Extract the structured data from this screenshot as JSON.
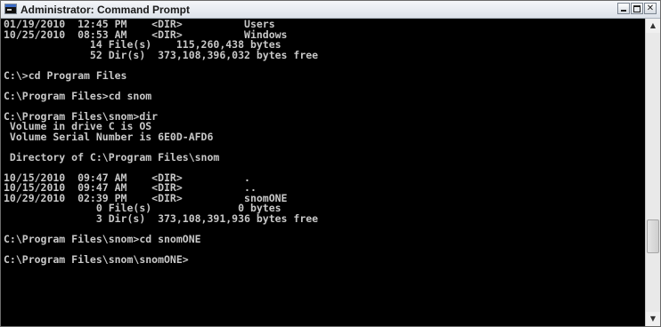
{
  "window": {
    "title": "Administrator: Command Prompt",
    "controls": {
      "minimize": "minimize",
      "maximize": "maximize",
      "close": "✕"
    }
  },
  "console": {
    "text_color": "#c8c8c8",
    "background_color": "#000000",
    "lines": [
      "01/19/2010  12:45 PM    <DIR>          Users",
      "10/25/2010  08:53 AM    <DIR>          Windows",
      "              14 File(s)    115,260,438 bytes",
      "              52 Dir(s)  373,108,396,032 bytes free",
      "",
      "C:\\>cd Program Files",
      "",
      "C:\\Program Files>cd snom",
      "",
      "C:\\Program Files\\snom>dir",
      " Volume in drive C is OS",
      " Volume Serial Number is 6E0D-AFD6",
      "",
      " Directory of C:\\Program Files\\snom",
      "",
      "10/15/2010  09:47 AM    <DIR>          .",
      "10/15/2010  09:47 AM    <DIR>          ..",
      "10/29/2010  02:39 PM    <DIR>          snomONE",
      "               0 File(s)              0 bytes",
      "               3 Dir(s)  373,108,391,936 bytes free",
      "",
      "C:\\Program Files\\snom>cd snomONE",
      "",
      "C:\\Program Files\\snom\\snomONE>"
    ]
  },
  "scrollbar": {
    "up_arrow": "▲",
    "down_arrow": "▼"
  },
  "icons": {
    "app": "command-prompt-icon"
  }
}
